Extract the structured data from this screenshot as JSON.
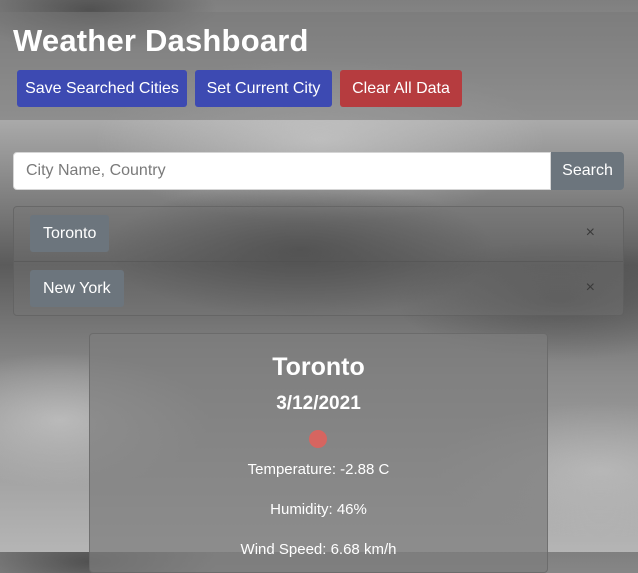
{
  "header": {
    "title": "Weather Dashboard",
    "buttons": {
      "save": "Save Searched Cities",
      "set_current": "Set Current City",
      "clear": "Clear All Data"
    }
  },
  "search": {
    "placeholder": "City Name, Country",
    "value": "",
    "button_label": "Search"
  },
  "cities": [
    {
      "name": "Toronto",
      "remove": "×"
    },
    {
      "name": "New York",
      "remove": "×"
    }
  ],
  "weather": {
    "city": "Toronto",
    "date": "3/12/2021",
    "icon": "weather-dot-icon",
    "temperature": "Temperature: -2.88 C",
    "humidity": "Humidity: 46%",
    "wind": "Wind Speed: 6.68 km/h"
  },
  "colors": {
    "primary_button": "#3d4ab2",
    "danger_button": "#b63c3f",
    "secondary_button": "#6c757d",
    "weather_dot": "#d66560"
  }
}
